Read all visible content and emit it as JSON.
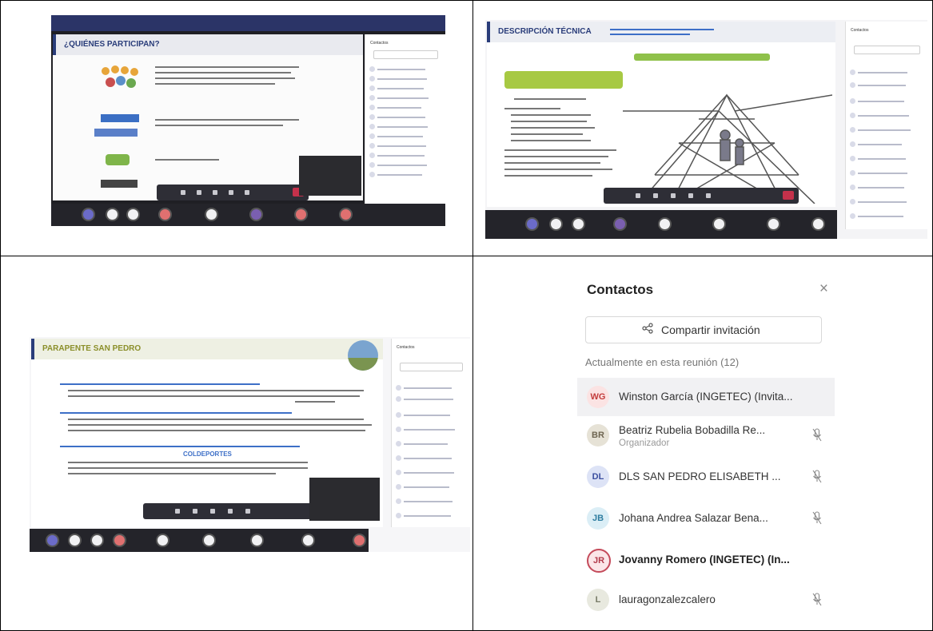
{
  "q1": {
    "slide_title": "¿QUIÉNES PARTICIPAN?",
    "panel_title": "Contactos"
  },
  "q2": {
    "slide_title": "DESCRIPCIÓN TÉCNICA",
    "panel_title": "Contactos"
  },
  "q3": {
    "slide_title": "PARAPENTE SAN PEDRO",
    "bullet_3": "COLDEPORTES",
    "panel_title": "Contactos"
  },
  "contacts": {
    "title": "Contactos",
    "close_glyph": "×",
    "share_label": "Compartir invitación",
    "section_label": "Actualmente en esta reunión (12)",
    "people": [
      {
        "initials": "WG",
        "name": "Winston García (INGETEC) (Invita...",
        "role": "",
        "muted": false,
        "bold": false,
        "avatar_bg": "#fbe3e3",
        "avatar_fg": "#c33c3c"
      },
      {
        "initials": "BR",
        "name": "Beatriz Rubelia Bobadilla Re...",
        "role": "Organizador",
        "muted": true,
        "bold": false,
        "avatar_bg": "#e6e2d6",
        "avatar_fg": "#6e6551"
      },
      {
        "initials": "DL",
        "name": "DLS SAN PEDRO ELISABETH ...",
        "role": "",
        "muted": true,
        "bold": false,
        "avatar_bg": "#dde3f6",
        "avatar_fg": "#3b4fa0"
      },
      {
        "initials": "JB",
        "name": "Johana Andrea Salazar Bena...",
        "role": "",
        "muted": true,
        "bold": false,
        "avatar_bg": "#dbeef6",
        "avatar_fg": "#2e7da0"
      },
      {
        "initials": "JR",
        "name": "Jovanny Romero (INGETEC) (In...",
        "role": "",
        "muted": false,
        "bold": true,
        "avatar_bg": "#fbe6e8",
        "avatar_fg": "#b23a4a"
      },
      {
        "initials": "L",
        "name": "lauragonzalezcalero",
        "role": "",
        "muted": true,
        "bold": false,
        "avatar_bg": "#e8e9df",
        "avatar_fg": "#777a66"
      }
    ]
  }
}
